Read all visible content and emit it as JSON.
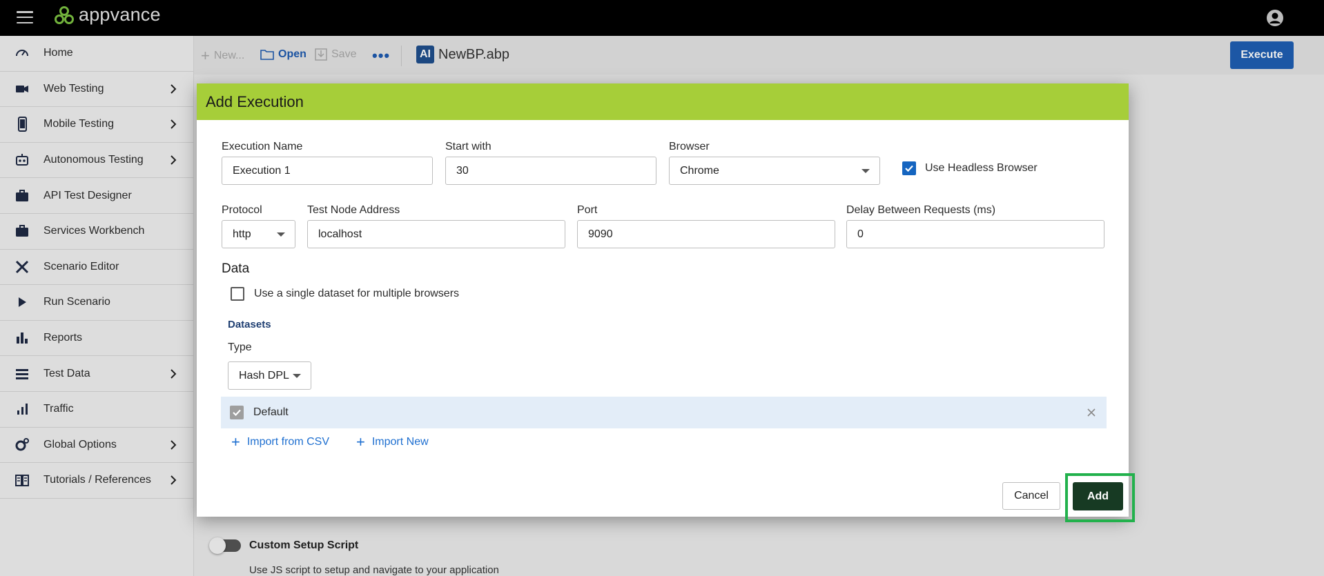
{
  "app": {
    "logo_text": "appvance"
  },
  "sidebar": {
    "items": [
      {
        "label": "Home",
        "icon": "speedometer-icon",
        "has_submenu": false
      },
      {
        "label": "Web Testing",
        "icon": "video-camera-icon",
        "has_submenu": true
      },
      {
        "label": "Mobile Testing",
        "icon": "smartphone-icon",
        "has_submenu": true
      },
      {
        "label": "Autonomous Testing",
        "icon": "robot-icon",
        "has_submenu": true
      },
      {
        "label": "API Test Designer",
        "icon": "briefcase-icon",
        "has_submenu": false
      },
      {
        "label": "Services Workbench",
        "icon": "briefcase-icon",
        "has_submenu": false
      },
      {
        "label": "Scenario Editor",
        "icon": "tools-icon",
        "has_submenu": false
      },
      {
        "label": "Run Scenario",
        "icon": "play-icon",
        "has_submenu": false
      },
      {
        "label": "Reports",
        "icon": "bar-chart-icon",
        "has_submenu": false
      },
      {
        "label": "Test Data",
        "icon": "list-icon",
        "has_submenu": true
      },
      {
        "label": "Traffic",
        "icon": "signal-bars-icon",
        "has_submenu": false
      },
      {
        "label": "Global Options",
        "icon": "gears-icon",
        "has_submenu": true
      },
      {
        "label": "Tutorials / References",
        "icon": "book-icon",
        "has_submenu": true
      }
    ]
  },
  "toolbar": {
    "new_label": "New...",
    "open_label": "Open",
    "save_label": "Save",
    "ai_badge": "AI",
    "file_name": "NewBP.abp",
    "execute_label": "Execute"
  },
  "background": {
    "custom_setup_title": "Custom Setup Script",
    "custom_setup_desc": "Use JS script to setup and navigate to your application"
  },
  "modal": {
    "title": "Add Execution",
    "execution_name_label": "Execution Name",
    "execution_name_value": "Execution 1",
    "start_with_label": "Start with",
    "start_with_value": "30",
    "browser_label": "Browser",
    "browser_value": "Chrome",
    "headless_label": "Use Headless Browser",
    "headless_checked": true,
    "protocol_label": "Protocol",
    "protocol_value": "http",
    "node_address_label": "Test Node Address",
    "node_address_value": "localhost",
    "port_label": "Port",
    "port_value": "9090",
    "delay_label": "Delay Between Requests (ms)",
    "delay_value": "0",
    "data_title": "Data",
    "single_dataset_label": "Use a single dataset for multiple browsers",
    "single_dataset_checked": false,
    "datasets_title": "Datasets",
    "type_label": "Type",
    "type_value": "Hash DPL",
    "dataset_row_label": "Default",
    "import_csv_label": "Import from CSV",
    "import_new_label": "Import New",
    "cancel_label": "Cancel",
    "add_label": "Add"
  },
  "colors": {
    "header_green": "#a6ce39",
    "primary_blue": "#1f5fb3",
    "add_button": "#173a23",
    "highlight": "#22b14c"
  }
}
